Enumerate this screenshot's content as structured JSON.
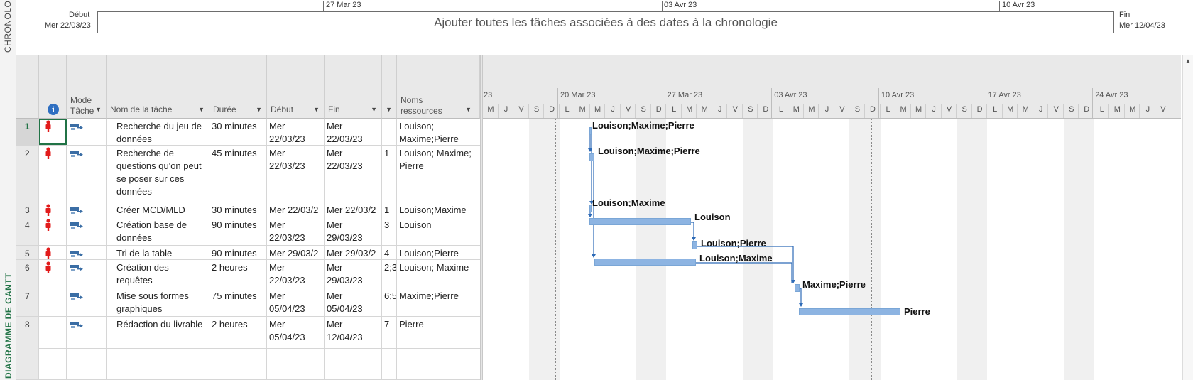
{
  "timeline": {
    "label": "CHRONOLOGIE",
    "start_label": "Début",
    "start_date": "Mer 22/03/23",
    "end_label": "Fin",
    "end_date": "Mer 12/04/23",
    "placeholder": "Ajouter toutes les tâches associées à des dates à la chronologie",
    "ticks": [
      "27 Mar 23",
      "03 Avr 23",
      "10 Avr 23"
    ]
  },
  "gantt_label": "DIAGRAMME DE GANTT",
  "columns": {
    "mode_line1": "Mode",
    "mode_line2": "Tâche",
    "name": "Nom de la tâche",
    "duration": "Durée",
    "start": "Début",
    "finish": "Fin",
    "resources_line1": "Noms",
    "resources_line2": "ressources"
  },
  "tasks": [
    {
      "id": "1",
      "name": "Recherche du jeu de données",
      "duration": "30 minutes",
      "start": "Mer 22/03/23",
      "finish": "Mer 22/03/23",
      "pred": "",
      "resources": "Louison; Maxime;Pierre",
      "bar_label": "Louison;Maxime;Pierre"
    },
    {
      "id": "2",
      "name": "Recherche de questions qu'on peut se poser sur ces données",
      "duration": "45 minutes",
      "start": "Mer 22/03/23",
      "finish": "Mer 22/03/23",
      "pred": "1",
      "resources": "Louison; Maxime; Pierre",
      "bar_label": "Louison;Maxime;Pierre"
    },
    {
      "id": "3",
      "name": "Créer MCD/MLD",
      "duration": "30 minutes",
      "start": "Mer 22/03/2",
      "finish": "Mer 22/03/2",
      "pred": "1",
      "resources": "Louison;Maxime",
      "bar_label": "Louison;Maxime"
    },
    {
      "id": "4",
      "name": "Création base de données",
      "duration": "90 minutes",
      "start": "Mer 22/03/23",
      "finish": "Mer 29/03/23",
      "pred": "3",
      "resources": "Louison",
      "bar_label": "Louison"
    },
    {
      "id": "5",
      "name": "Tri de la table",
      "duration": "90 minutes",
      "start": "Mer 29/03/2",
      "finish": "Mer 29/03/2",
      "pred": "4",
      "resources": "Louison;Pierre",
      "bar_label": "Louison;Pierre"
    },
    {
      "id": "6",
      "name": "Création des requêtes",
      "duration": "2 heures",
      "start": "Mer 22/03/23",
      "finish": "Mer 29/03/23",
      "pred": "2;3",
      "resources": "Louison; Maxime",
      "bar_label": "Louison;Maxime"
    },
    {
      "id": "7",
      "name": "Mise sous formes graphiques",
      "duration": "75 minutes",
      "start": "Mer 05/04/23",
      "finish": "Mer 05/04/23",
      "pred": "6;5",
      "resources": "Maxime;Pierre",
      "bar_label": "Maxime;Pierre"
    },
    {
      "id": "8",
      "name": "Rédaction du livrable",
      "duration": "2 heures",
      "start": "Mer 05/04/23",
      "finish": "Mer 12/04/23",
      "pred": "7",
      "resources": "Pierre",
      "bar_label": "Pierre"
    }
  ],
  "chart_header": {
    "partial_week": "23",
    "weeks": [
      "20 Mar 23",
      "27 Mar 23",
      "03 Avr 23",
      "10 Avr 23",
      "17 Avr 23",
      "24 Avr 23"
    ],
    "day_letters": [
      "M",
      "J",
      "V",
      "S",
      "D",
      "L",
      "M",
      "M",
      "J",
      "V",
      "S",
      "D",
      "L",
      "M",
      "M",
      "J",
      "V",
      "S",
      "D",
      "L",
      "M",
      "M",
      "J",
      "V",
      "S",
      "D",
      "L",
      "M",
      "M",
      "J",
      "V",
      "S",
      "D",
      "L",
      "M",
      "M",
      "J",
      "V",
      "S",
      "D",
      "L",
      "M",
      "M",
      "J",
      "V"
    ]
  }
}
